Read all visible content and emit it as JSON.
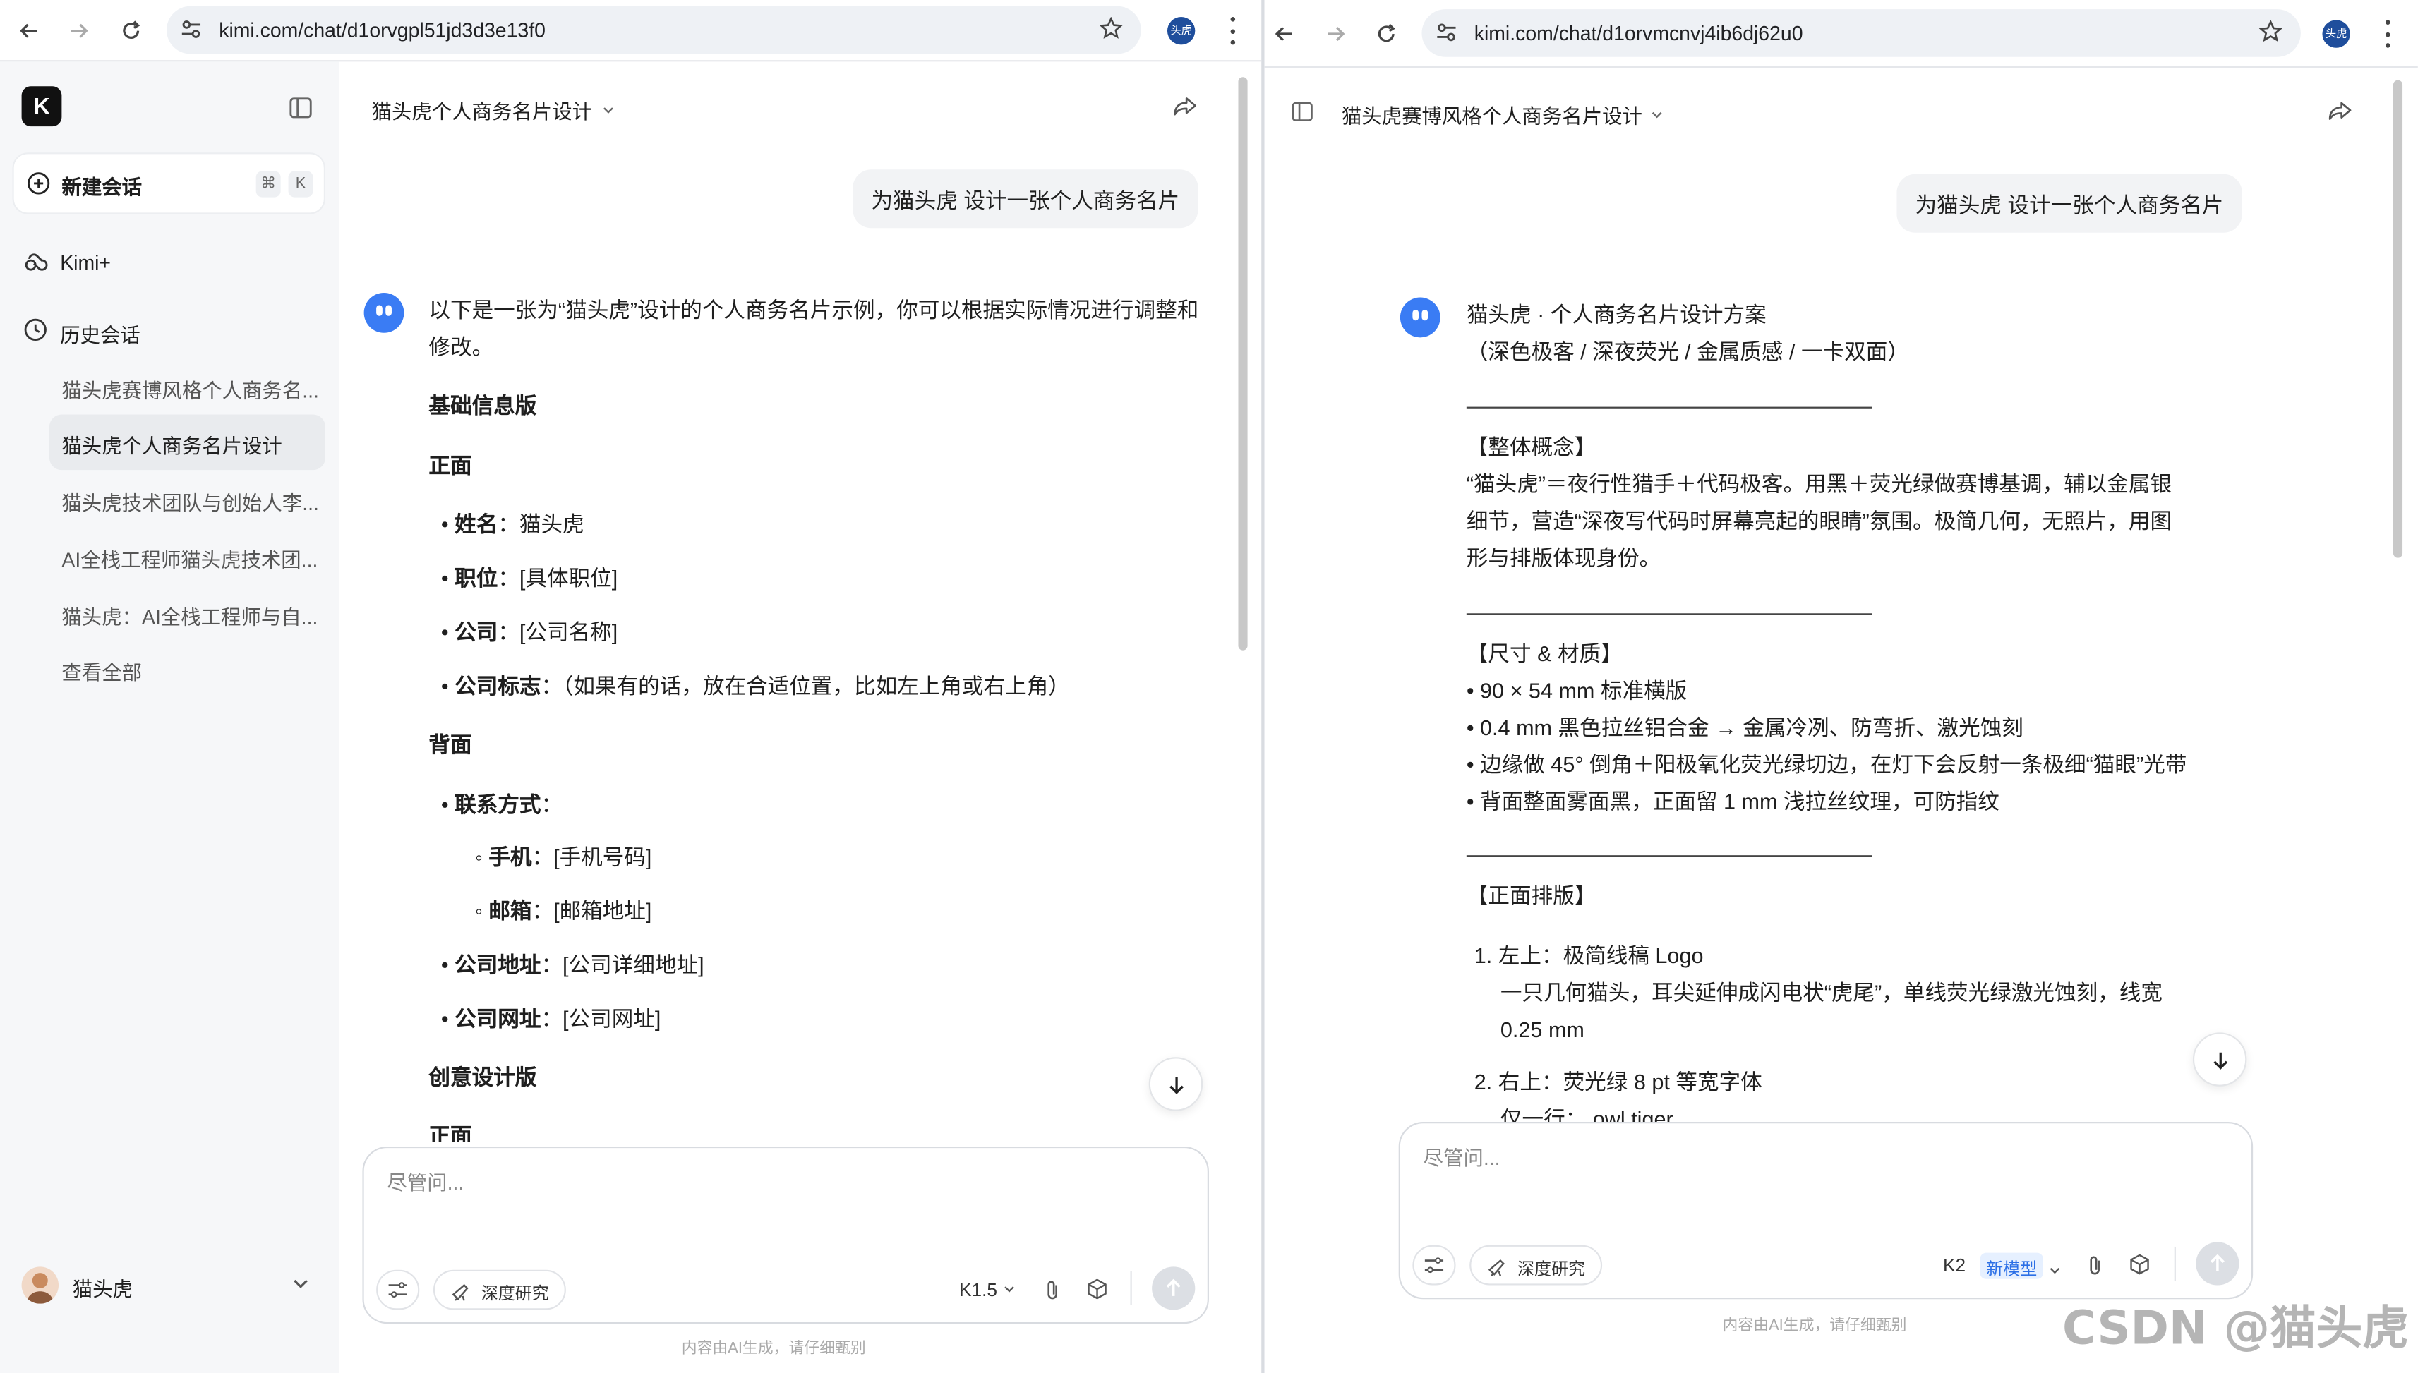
{
  "left": {
    "url": "kimi.com/chat/d1orvgpl51jd3d3e13f0",
    "profile_label": "头虎",
    "sidebar": {
      "new_chat": "新建会话",
      "shortcut_keys": [
        "⌘",
        "K"
      ],
      "kimi_plus": "Kimi+",
      "history_title": "历史会话",
      "history_items": [
        "猫头虎赛博风格个人商务名...",
        "猫头虎个人商务名片设计",
        "猫头虎技术团队与创始人李...",
        "AI全栈工程师猫头虎技术团...",
        "猫头虎：AI全栈工程师与自...",
        "查看全部"
      ],
      "user_name": "猫头虎"
    },
    "chat_title": "猫头虎个人商务名片设计",
    "user_message": "为猫头虎 设计一张个人商务名片",
    "answer": {
      "intro": "以下是一张为“猫头虎”设计的个人商务名片示例，你可以根据实际情况进行调整和修改。",
      "section_basic": "基础信息版",
      "front": "正面",
      "front_items": [
        {
          "k": "姓名",
          "v": "：猫头虎"
        },
        {
          "k": "职位",
          "v": "：[具体职位]"
        },
        {
          "k": "公司",
          "v": "：[公司名称]"
        },
        {
          "k": "公司标志",
          "v": "：（如果有的话，放在合适位置，比如左上角或右上角）"
        }
      ],
      "back": "背面",
      "contact": {
        "k": "联系方式",
        "v": "："
      },
      "contact_items": [
        {
          "k": "手机",
          "v": "：[手机号码]"
        },
        {
          "k": "邮箱",
          "v": "：[邮箱地址]"
        }
      ],
      "back_items": [
        {
          "k": "公司地址",
          "v": "：[公司详细地址]"
        },
        {
          "k": "公司网址",
          "v": "：[公司网址]"
        }
      ],
      "section_creative": "创意设计版",
      "front2": "正面"
    },
    "input_placeholder": "尽管问...",
    "deep_research": "深度研究",
    "model": "K1.5",
    "footer": "内容由AI生成，请仔细甄别"
  },
  "right": {
    "url": "kimi.com/chat/d1orvmcnvj4ib6dj62u0",
    "profile_label": "头虎",
    "chat_title": "猫头虎赛博风格个人商务名片设计",
    "user_message": "为猫头虎 设计一张个人商务名片",
    "answer": {
      "title": "猫头虎 · 个人商务名片设计方案",
      "subtitle": "（深色极客 / 深夜荧光 / 金属质感 / 一卡双面）",
      "concept_h": "【整体概念】",
      "concept_lines": [
        "“猫头虎”＝夜行性猎手＋代码极客。用黑＋荧光绿做赛博基调，辅以金属银",
        "细节，营造“深夜写代码时屏幕亮起的眼睛”氛围。极简几何，无照片，用图",
        "形与排版体现身份。"
      ],
      "size_h": "【尺寸 & 材质】",
      "size_lines": [
        "• 90 × 54 mm 标准横版",
        "• 0.4 mm 黑色拉丝铝合金 → 金属冷冽、防弯折、激光蚀刻",
        "• 边缘做 45° 倒角＋阳极氧化荧光绿切边，在灯下会反射一条极细“猫眼”光带",
        "• 背面整面雾面黑，正面留 1 mm 浅拉丝纹理，可防指纹"
      ],
      "layout_h": "【正面排版】",
      "items": [
        {
          "n": "1.",
          "t": "左上：极简线稿 Logo",
          "d": [
            "一只几何猫头，耳尖延伸成闪电状“虎尾”，单线荧光绿激光蚀刻，线宽",
            "0.25 mm"
          ]
        },
        {
          "n": "2.",
          "t": "右上：荧光绿 8 pt 等宽字体",
          "d": [
            "仅一行：  owl.tiger"
          ]
        }
      ]
    },
    "input_placeholder": "尽管问...",
    "deep_research": "深度研究",
    "model": "K2",
    "model_tag": "新模型",
    "footer": "内容由AI生成，请仔细甄别"
  },
  "watermark": "CSDN @猫头虎",
  "colors": {
    "accent": "#3a7cf4",
    "sidebar_bg": "#f6f7f9",
    "bubble_bg": "#f2f3f5"
  }
}
